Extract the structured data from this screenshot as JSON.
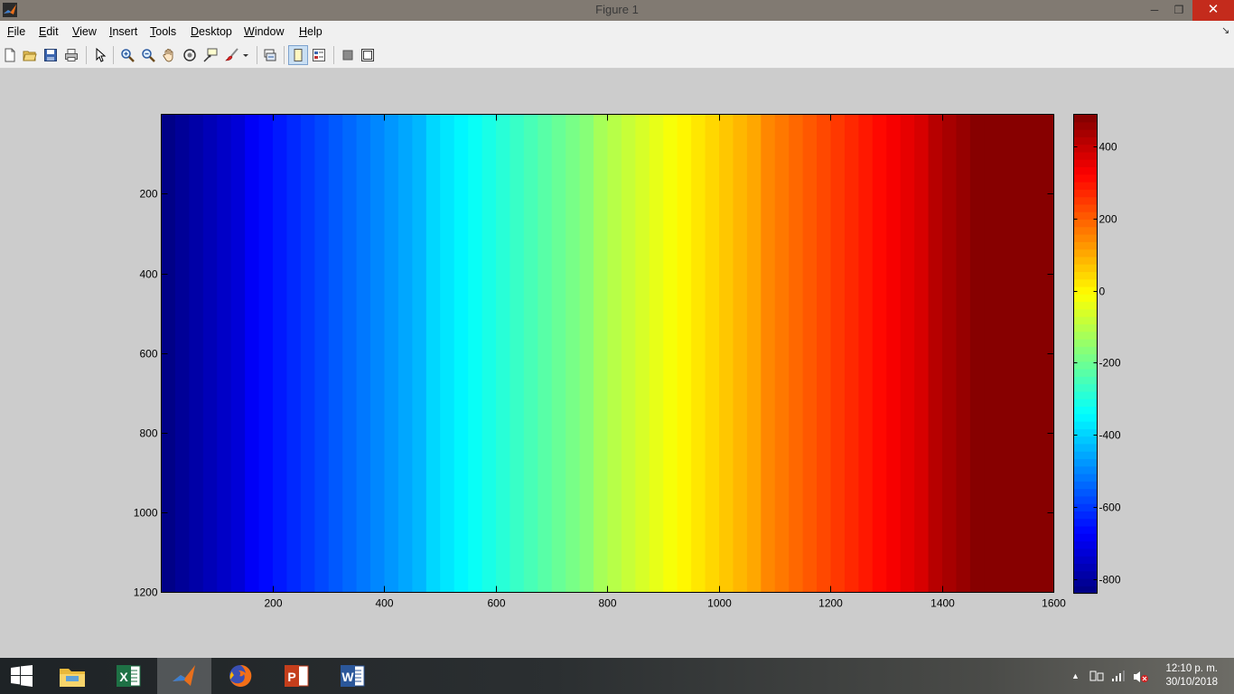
{
  "window": {
    "title": "Figure 1",
    "minimize": "─",
    "restore": "❐",
    "close": "✕"
  },
  "menubar": {
    "items": [
      {
        "key": "F",
        "rest": "ile"
      },
      {
        "key": "E",
        "rest": "dit"
      },
      {
        "key": "V",
        "rest": "iew"
      },
      {
        "key": "I",
        "rest": "nsert"
      },
      {
        "key": "T",
        "rest": "ools"
      },
      {
        "key": "D",
        "rest": "esktop"
      },
      {
        "key": "W",
        "rest": "indow"
      },
      {
        "key": "H",
        "rest": "elp"
      }
    ],
    "dock_arrow": "↘"
  },
  "toolbar": {
    "icons": [
      "new-figure-icon",
      "open-file-icon",
      "save-icon",
      "print-icon",
      "edit-plot-arrow-icon",
      "zoom-in-icon",
      "zoom-out-icon",
      "pan-hand-icon",
      "rotate-3d-icon",
      "data-cursor-icon",
      "brush-icon",
      "link-plot-icon",
      "hide-plot-tools-icon",
      "show-plot-tools-icon",
      "insert-colorbar-icon",
      "insert-legend-icon"
    ]
  },
  "chart_data": {
    "type": "heatmap",
    "colormap": "jet",
    "x": {
      "range": [
        0.5,
        1600.5
      ],
      "ticks": [
        200,
        400,
        600,
        800,
        1000,
        1200,
        1400,
        1600
      ]
    },
    "y": {
      "range": [
        0.5,
        1200.5
      ],
      "reversed": true,
      "ticks": [
        200,
        400,
        600,
        800,
        1000,
        1200
      ]
    },
    "values": {
      "description_formula": "c = x - 1000",
      "x_bin_width": 25,
      "clim": [
        -999,
        480
      ]
    },
    "colorbar": {
      "range": [
        -840,
        490
      ],
      "ticks": [
        -800,
        -600,
        -400,
        -200,
        0,
        200,
        400
      ],
      "levels": 64,
      "location": "right"
    },
    "title": "",
    "xlabel": "",
    "ylabel": ""
  },
  "taskbar": {
    "apps": [
      {
        "name": "start-icon"
      },
      {
        "name": "file-explorer-icon"
      },
      {
        "name": "excel-icon",
        "label": "X"
      },
      {
        "name": "matlab-icon"
      },
      {
        "name": "firefox-icon"
      },
      {
        "name": "powerpoint-icon",
        "label": "P"
      },
      {
        "name": "word-icon",
        "label": "W"
      }
    ],
    "tray": {
      "chevron": "▲"
    },
    "clock": {
      "time": "12:10 p. m.",
      "date": "30/10/2018"
    }
  },
  "colors": {
    "titlebar": "#817a72",
    "close_button": "#c42b1c",
    "figure_bg": "#cccccc",
    "menubar": "#f0f0f0"
  }
}
